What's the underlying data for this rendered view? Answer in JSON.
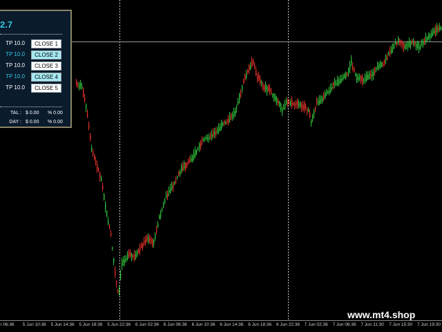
{
  "panel": {
    "title": "2.7",
    "rows": [
      {
        "tp": "TP 10.0",
        "close": "CLOSE 1",
        "highlight": false
      },
      {
        "tp": "TP 10.0",
        "close": "CLOSE 2",
        "highlight": true
      },
      {
        "tp": "TP 10.0",
        "close": "CLOSE 3",
        "highlight": false
      },
      {
        "tp": "TP 10.0",
        "close": "CLOSE 4",
        "highlight": true
      },
      {
        "tp": "TP 10.0",
        "close": "CLOSE 5",
        "highlight": false
      }
    ],
    "stats": [
      {
        "label": "TAL :",
        "value": "$ 0.00",
        "pct": "% 0.00"
      },
      {
        "label": "DAY :",
        "value": "$ 0.00",
        "pct": "% 0.00"
      }
    ]
  },
  "watermark": "www.mt4.shop",
  "colors": {
    "background": "#000000",
    "bull_candle": "#2fbf3a",
    "bear_candle": "#e0302a",
    "panel_bg": "#0a1b2c",
    "panel_border": "#8b8566",
    "accent": "#34c4e3"
  },
  "x_axis_labels": [
    "Jun 06:36",
    "5 Jun 10:36",
    "5 Jun 14:36",
    "5 Jun 18:36",
    "5 Jun 22:36",
    "6 Jun 02:36",
    "6 Jun 06:36",
    "6 Jun 10:36",
    "6 Jun 14:36",
    "6 Jun 18:36",
    "6 Jun 22:36",
    "7 Jun 02:36",
    "7 Jun 06:36",
    "7 Jun 11:30",
    "7 Jun 15:30",
    "7 Jun 19:30"
  ]
}
